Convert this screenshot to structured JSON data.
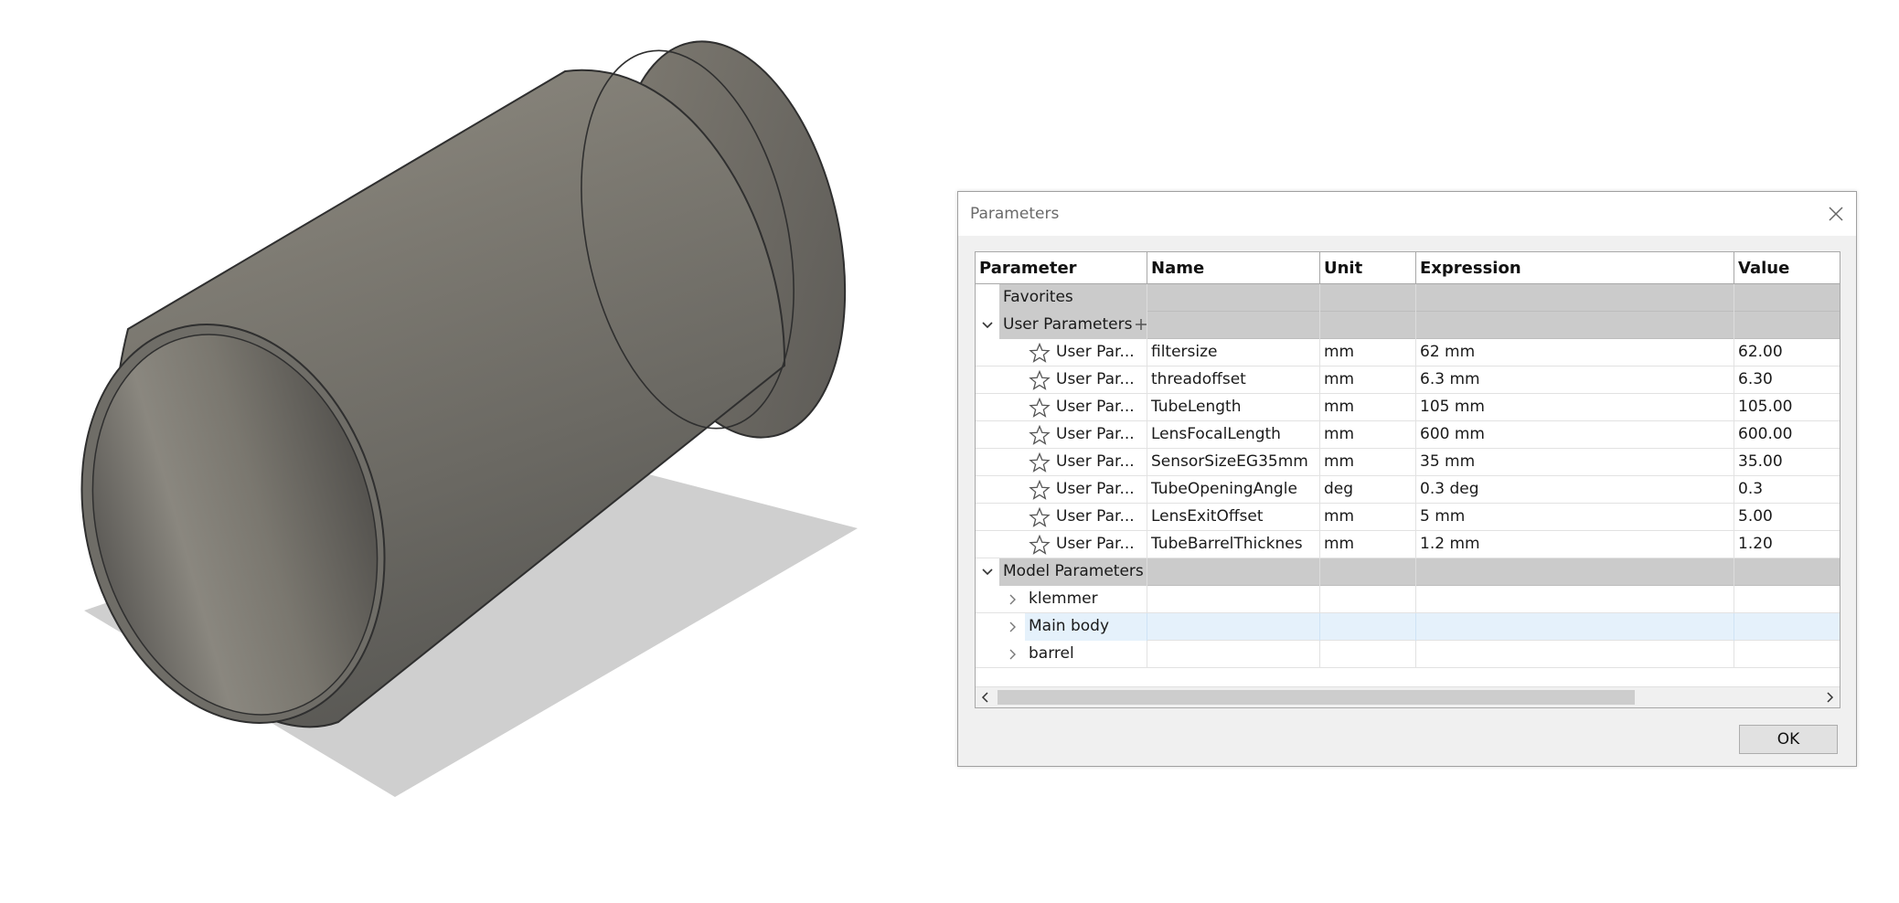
{
  "dialog": {
    "title": "Parameters",
    "ok_label": "OK"
  },
  "table": {
    "headers": [
      "Parameter",
      "Name",
      "Unit",
      "Expression",
      "Value"
    ],
    "groups": {
      "favorites": "Favorites",
      "user": "User Parameters",
      "model": "Model Parameters"
    },
    "user_rows": [
      {
        "param": "User Par...",
        "name": "filtersize",
        "unit": "mm",
        "expr": "62 mm",
        "value": "62.00"
      },
      {
        "param": "User Par...",
        "name": "threadoffset",
        "unit": "mm",
        "expr": "6.3 mm",
        "value": "6.30"
      },
      {
        "param": "User Par...",
        "name": "TubeLength",
        "unit": "mm",
        "expr": "105 mm",
        "value": "105.00"
      },
      {
        "param": "User Par...",
        "name": "LensFocalLength",
        "unit": "mm",
        "expr": "600 mm",
        "value": "600.00"
      },
      {
        "param": "User Par...",
        "name": "SensorSizeEG35mm",
        "unit": "mm",
        "expr": "35 mm",
        "value": "35.00"
      },
      {
        "param": "User Par...",
        "name": "TubeOpeningAngle",
        "unit": "deg",
        "expr": "0.3 deg",
        "value": "0.3"
      },
      {
        "param": "User Par...",
        "name": "LensExitOffset",
        "unit": "mm",
        "expr": "5 mm",
        "value": "5.00"
      },
      {
        "param": "User Par...",
        "name": "TubeBarrelThicknes",
        "unit": "mm",
        "expr": "1.2 mm",
        "value": "1.20"
      }
    ],
    "model_rows": [
      {
        "label": "klemmer",
        "selected": false
      },
      {
        "label": "Main body",
        "selected": true
      },
      {
        "label": "barrel",
        "selected": false
      }
    ]
  },
  "icons": {
    "close": "close-icon",
    "expand": "chevron-down-icon",
    "collapse": "chevron-right-icon",
    "favorite": "star-outline-icon",
    "add": "plus-icon"
  },
  "colors": {
    "group_bg": "#cbcbcb",
    "selected_bg": "#e5f1fb",
    "tube": "#7a7770",
    "shadow": "#cfcfcf"
  }
}
